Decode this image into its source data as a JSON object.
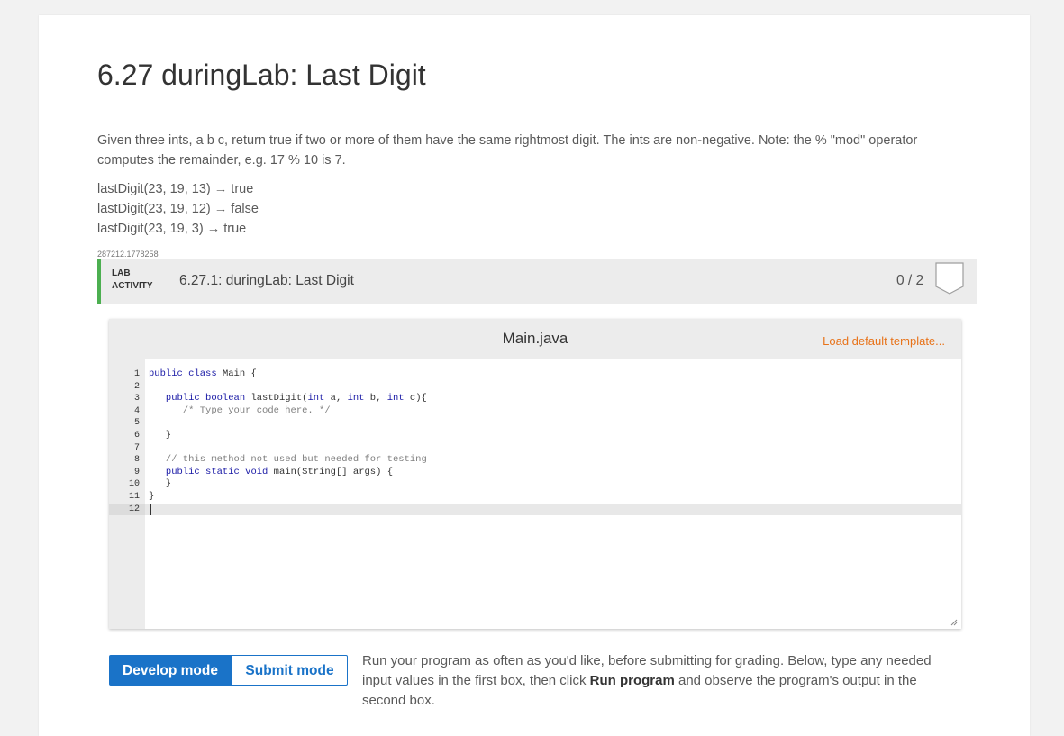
{
  "page": {
    "title": "6.27 duringLab: Last Digit",
    "description": "Given three ints, a b c, return true if two or more of them have the same rightmost digit. The ints are non-negative. Note: the % \"mod\" operator computes the remainder, e.g. 17 % 10 is 7.",
    "examples": [
      "lastDigit(23, 19, 13) → true",
      "lastDigit(23, 19, 12) → false",
      "lastDigit(23, 19, 3) → true"
    ],
    "problem_id": "287212.1778258"
  },
  "lab": {
    "badge_line1": "LAB",
    "badge_line2": "ACTIVITY",
    "title": "6.27.1: duringLab: Last Digit",
    "score": "0 / 2",
    "accent_color": "#4caf50"
  },
  "editor": {
    "file_name": "Main.java",
    "load_template": "Load default template...",
    "active_line": 12,
    "lines": [
      "public class Main {",
      "",
      "   public boolean lastDigit(int a, int b, int c){",
      "      /* Type your code here. */",
      "",
      "   }",
      "",
      "   // this method not used but needed for testing",
      "   public static void main(String[] args) {",
      "   }",
      "}",
      ""
    ]
  },
  "modes": {
    "develop": "Develop mode",
    "submit": "Submit mode",
    "active": "develop",
    "active_color": "#1a73c8"
  },
  "instructions": {
    "before": "Run your program as often as you'd like, before submitting for grading. Below, type any needed input values in the first box, then click ",
    "bold": "Run program",
    "after": " and observe the program's output in the second box."
  }
}
